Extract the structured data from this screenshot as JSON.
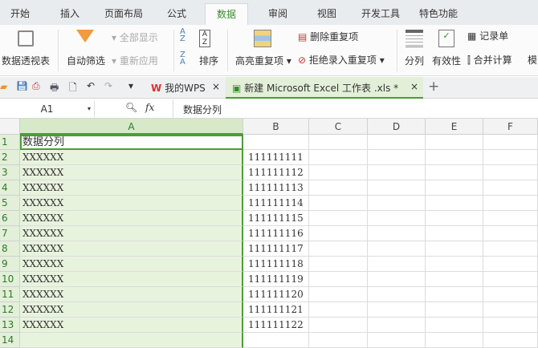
{
  "tabs": [
    "开始",
    "插入",
    "页面布局",
    "公式",
    "数据",
    "审阅",
    "视图",
    "开发工具",
    "特色功能"
  ],
  "ribbon": {
    "pivot": "数据透视表",
    "autofilter": "自动筛选",
    "show_all": "全部显示",
    "reapply": "重新应用",
    "sort": "排序",
    "highlight_dup": "高亮重复项",
    "remove_dup": "删除重复项",
    "reject_dup": "拒绝录入重复项",
    "split": "分列",
    "validity": "有效性",
    "record": "记录单",
    "consolidate": "合并计算",
    "more": "模"
  },
  "doc_tabs": {
    "wps": "我的WPS",
    "file": "新建 Microsoft Excel 工作表 .xls *",
    "close": "×",
    "add": "+"
  },
  "formula": {
    "cell_ref": "A1",
    "fx": "fx",
    "value": "数据分列"
  },
  "columns": [
    "A",
    "B",
    "C",
    "D",
    "E",
    "F"
  ],
  "rows": [
    {
      "n": "1",
      "a": "数据分列",
      "b": ""
    },
    {
      "n": "2",
      "a": "XXXXXX",
      "b": "111111111"
    },
    {
      "n": "3",
      "a": "XXXXXX",
      "b": "111111112"
    },
    {
      "n": "4",
      "a": "XXXXXX",
      "b": "111111113"
    },
    {
      "n": "5",
      "a": "XXXXXX",
      "b": "111111114"
    },
    {
      "n": "6",
      "a": "XXXXXX",
      "b": "111111115"
    },
    {
      "n": "7",
      "a": "XXXXXX",
      "b": "111111116"
    },
    {
      "n": "8",
      "a": "XXXXXX",
      "b": "111111117"
    },
    {
      "n": "9",
      "a": "XXXXXX",
      "b": "111111118"
    },
    {
      "n": "10",
      "a": "XXXXXX",
      "b": "111111119"
    },
    {
      "n": "11",
      "a": "XXXXXX",
      "b": "111111120"
    },
    {
      "n": "12",
      "a": "XXXXXX",
      "b": "111111121"
    },
    {
      "n": "13",
      "a": "XXXXXX",
      "b": "111111122"
    },
    {
      "n": "14",
      "a": "",
      "b": ""
    }
  ]
}
